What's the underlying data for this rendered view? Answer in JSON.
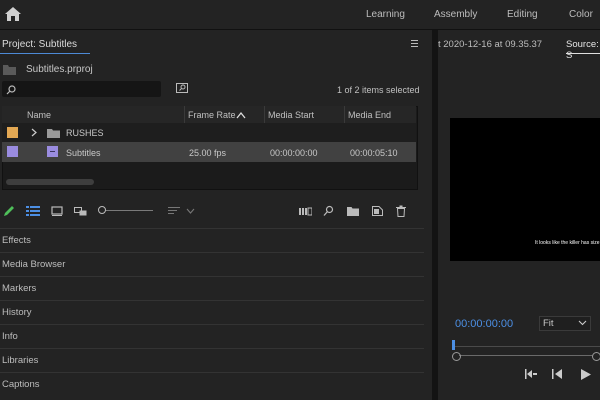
{
  "workspaces": [
    "Learning",
    "Assembly",
    "Editing",
    "Color"
  ],
  "project": {
    "title": "Project: Subtitles",
    "file_name": "Subtitles.prproj",
    "search_placeholder": "",
    "items_selected": "1 of 2 items selected",
    "columns": [
      "Name",
      "Frame Rate",
      "Media Start",
      "Media End"
    ],
    "rows": [
      {
        "color": "#e3a853",
        "type": "folder",
        "name": "RUSHES",
        "frame_rate": "",
        "media_start": "",
        "media_end": "",
        "selected": false
      },
      {
        "color": "#9a8ce0",
        "type": "sequence",
        "name": "Subtitles",
        "frame_rate": "25.00 fps",
        "media_start": "00:00:00:00",
        "media_end": "00:00:05:10",
        "selected": true
      }
    ]
  },
  "panels": [
    "Effects",
    "Media Browser",
    "Markers",
    "History",
    "Info",
    "Libraries",
    "Captions"
  ],
  "monitor": {
    "timestamp": "t 2020-12-16 at 09.35.37",
    "source_tab": "Source: S",
    "subtitle": "It looks like the killer has size",
    "timecode": "00:00:00:00",
    "fit": "Fit"
  },
  "colors": {
    "accent": "#4c8fe4",
    "selected_row": "#414141"
  }
}
